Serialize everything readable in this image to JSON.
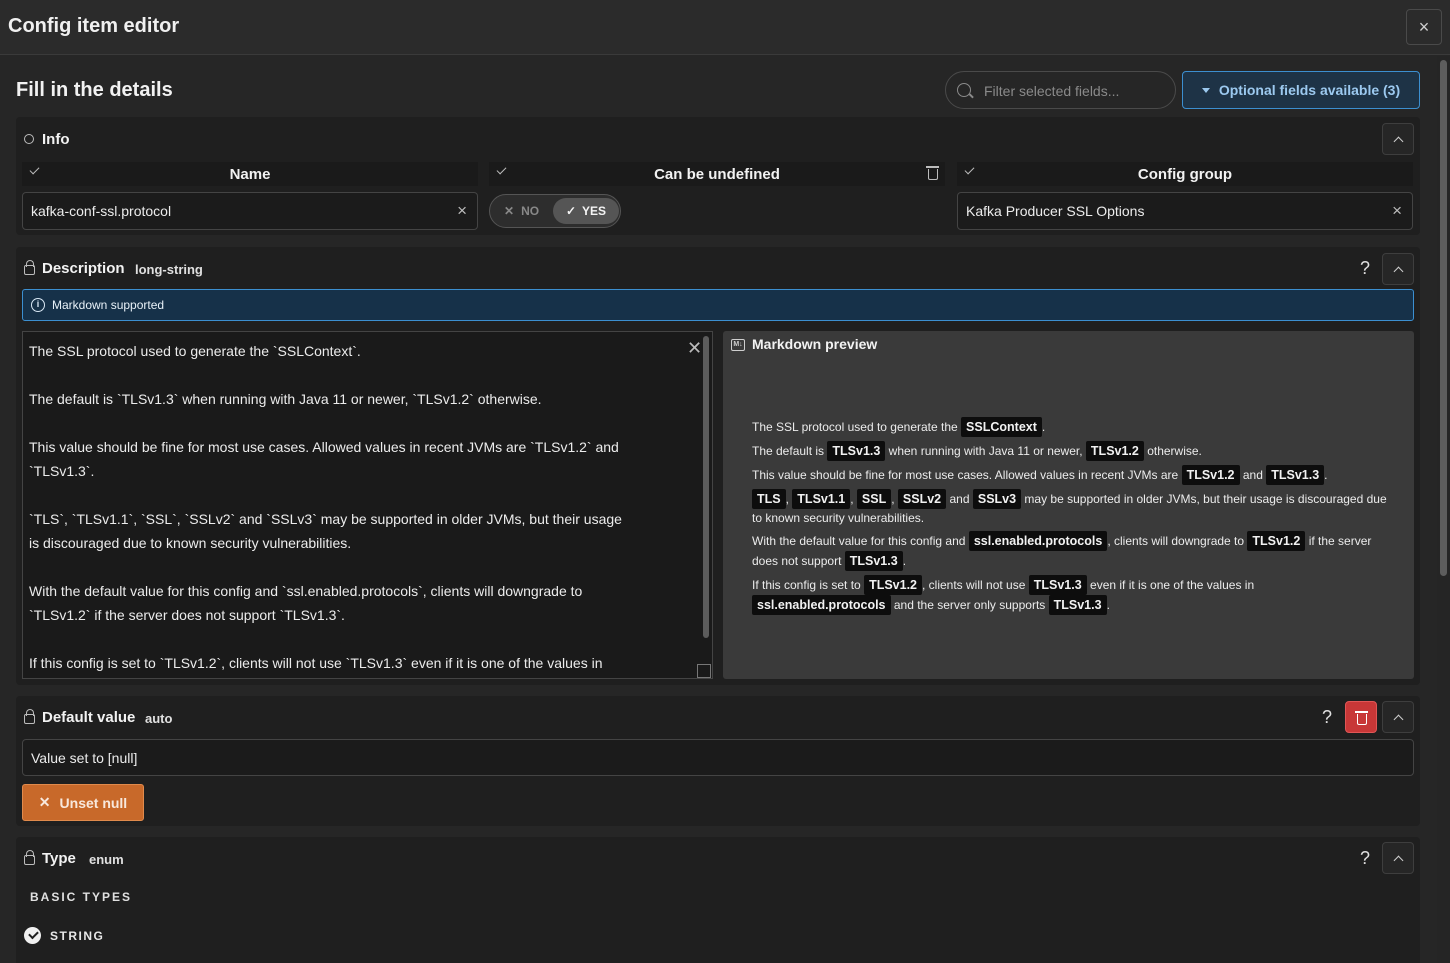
{
  "window": {
    "title": "Config item editor",
    "close_label": "×"
  },
  "header": {
    "title": "Fill in the details",
    "filter_placeholder": "Filter selected fields...",
    "optional_fields_label": "Optional fields available (3)"
  },
  "info": {
    "title": "Info",
    "name": {
      "label": "Name",
      "value": "kafka-conf-ssl.protocol"
    },
    "can_be_undefined": {
      "label": "Can be undefined",
      "no_label": "NO",
      "yes_label": "YES",
      "selected": "YES"
    },
    "config_group": {
      "label": "Config group",
      "value": "Kafka Producer SSL Options"
    }
  },
  "description": {
    "title": "Description",
    "type": "long-string",
    "banner": "Markdown supported",
    "editor_lines": [
      "The SSL protocol used to generate the `SSLContext`.",
      "",
      "The default is `TLSv1.3` when running with Java 11 or newer, `TLSv1.2` otherwise.",
      "",
      "This value should be fine for most use cases. Allowed values in recent JVMs are `TLSv1.2` and",
      "`TLSv1.3`.",
      "",
      "`TLS`, `TLSv1.1`, `SSL`, `SSLv2` and `SSLv3` may be supported in older JVMs, but their usage",
      "is discouraged due to known security vulnerabilities.",
      "",
      "With the default value for this config and `ssl.enabled.protocols`, clients will downgrade to",
      "`TLSv1.2` if the server does not support `TLSv1.3`.",
      "",
      "If this config is set to `TLSv1.2`, clients will not use `TLSv1.3` even if it is one of the values in"
    ],
    "preview": {
      "title": "Markdown preview",
      "p1": {
        "a": "The SSL protocol used to generate the",
        "c1": "SSLContext",
        "b": "."
      },
      "p2": {
        "a": "The default is",
        "c1": "TLSv1.3",
        "b": "when running with Java 11 or newer,",
        "c2": "TLSv1.2",
        "c": "otherwise."
      },
      "p3": {
        "a": "This value should be fine for most use cases. Allowed values in recent JVMs are",
        "c1": "TLSv1.2",
        "b": "and",
        "c2": "TLSv1.3",
        "c": "."
      },
      "p4": {
        "c1": "TLS",
        "s1": ",",
        "c2": "TLSv1.1",
        "s2": ",",
        "c3": "SSL",
        "s3": ",",
        "c4": "SSLv2",
        "s4": "and",
        "c5": "SSLv3",
        "t": "may be supported in older JVMs, but their usage is discouraged due to known security vulnerabilities."
      },
      "p5": {
        "a": "With the default value for this config and",
        "c1": "ssl.enabled.protocols",
        "b": ", clients will downgrade to",
        "c2": "TLSv1.2",
        "c": "if the server does not support",
        "c3": "TLSv1.3",
        "d": "."
      },
      "p6": {
        "a": "If this config is set to",
        "c1": "TLSv1.2",
        "b": ", clients will not use",
        "c2": "TLSv1.3",
        "c": "even if it is one of the values in",
        "c3": "ssl.enabled.protocols",
        "d": "and the server only supports",
        "c4": "TLSv1.3",
        "e": "."
      }
    }
  },
  "default_value": {
    "title": "Default value",
    "type": "auto",
    "value": "Value set to [null]",
    "unset_label": "Unset null"
  },
  "type_section": {
    "title": "Type",
    "type": "enum",
    "group_label": "BASIC TYPES",
    "selected_option": "STRING"
  },
  "help_label": "?",
  "colors": {
    "accent_blue": "#3c8fd0",
    "unset_orange": "#c8692a",
    "delete_red": "#c83737"
  }
}
